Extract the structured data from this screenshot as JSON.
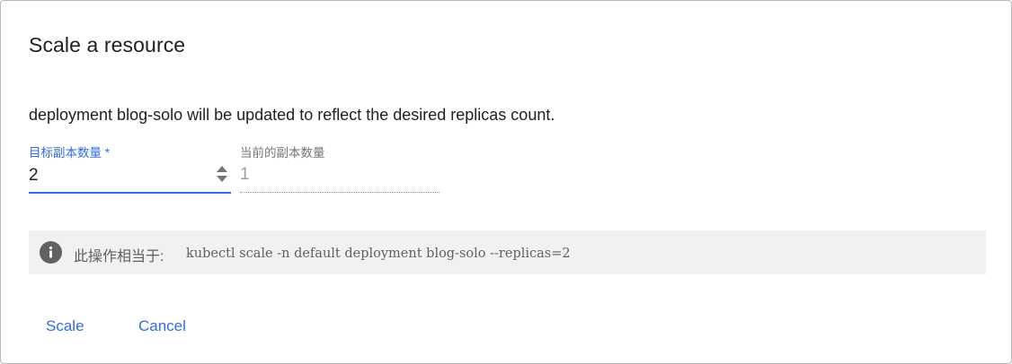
{
  "dialog": {
    "title": "Scale a resource",
    "description": "deployment blog-solo will be updated to reflect the desired replicas count."
  },
  "target_replicas": {
    "label": "目标副本数量 *",
    "value": "2"
  },
  "current_replicas": {
    "label": "当前的副本数量",
    "value": "1"
  },
  "info": {
    "icon": "info-icon",
    "label": "此操作相当于:",
    "command": "kubectl scale -n default deployment blog-solo --replicas=2"
  },
  "actions": {
    "scale_label": "Scale",
    "cancel_label": "Cancel"
  },
  "colors": {
    "accent": "#326de6",
    "info_background": "#f1f1f1"
  }
}
